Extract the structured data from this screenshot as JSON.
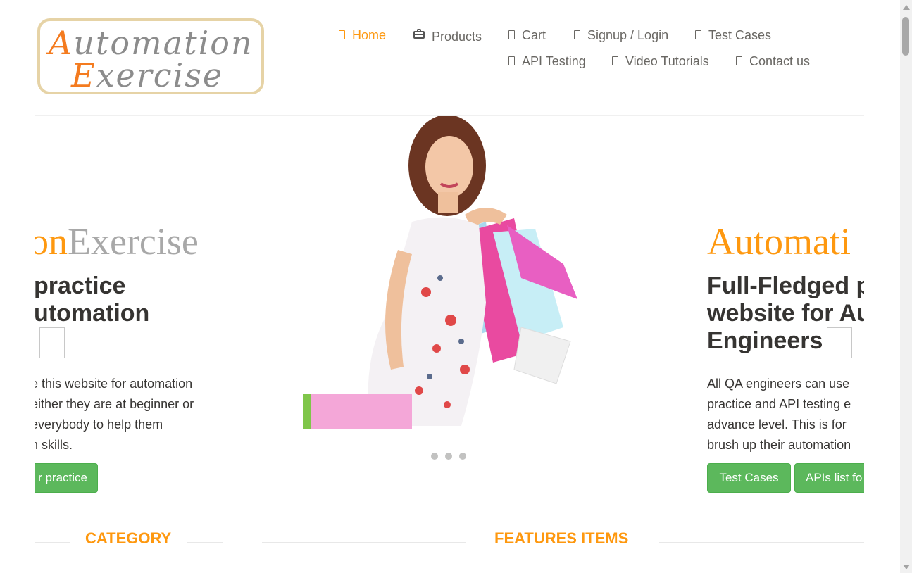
{
  "logo": {
    "line1_first": "A",
    "line1_rest": "utomation",
    "line2_first": "E",
    "line2_rest": "xercise"
  },
  "nav": {
    "home": "Home",
    "products": "Products",
    "cart": "Cart",
    "signup_login": "Signup / Login",
    "test_cases": "Test Cases",
    "api_testing": "API Testing",
    "video_tutorials": "Video Tutorials",
    "contact_us": "Contact us"
  },
  "slider": {
    "left": {
      "title_a": "on",
      "title_b": "Exercise",
      "heading_line1": "practice",
      "heading_line2": "utomation",
      "para": [
        "e this website for automation",
        "either they are at beginner or",
        " everybody to help them",
        "n skills."
      ],
      "button": "r practice"
    },
    "right": {
      "title_a": "Automati",
      "heading_line1": "Full-Fledged p",
      "heading_line2": "website for Au",
      "heading_line3": "Engineers",
      "para": [
        "All QA engineers can use",
        "practice and API testing e",
        "advance level. This is for",
        "brush up their automation"
      ],
      "button_test_cases": "Test Cases",
      "button_apis": "APIs list fo"
    }
  },
  "sections": {
    "category": "CATEGORY",
    "features": "FEATURES ITEMS"
  },
  "colors": {
    "accent": "#fe980f",
    "button_green": "#5cb85c",
    "heading": "#363432"
  }
}
